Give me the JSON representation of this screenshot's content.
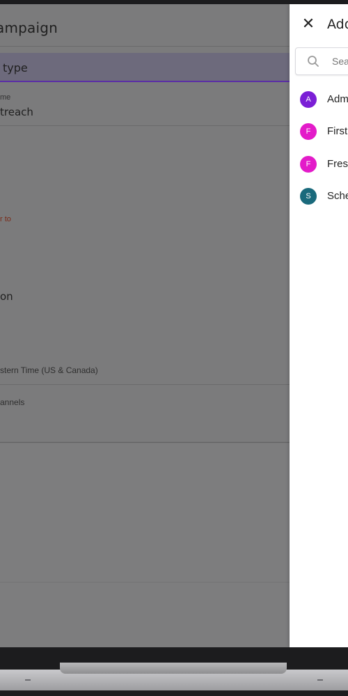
{
  "page": {
    "title": "ampaign",
    "type_field": "type",
    "name_label": "me",
    "name_value": "treach",
    "hint": "r to",
    "option_value": "on",
    "timezone": "stern Time (US & Canada)",
    "channels_label": "annels"
  },
  "drawer": {
    "title": "Add",
    "search_placeholder": "Sea",
    "items": [
      {
        "initial": "A",
        "label": "Adm",
        "color": "#7b1fd6"
      },
      {
        "initial": "F",
        "label": "First",
        "color": "#e31bc9"
      },
      {
        "initial": "F",
        "label": "Fres",
        "color": "#e31bc9"
      },
      {
        "initial": "S",
        "label": "Sche",
        "color": "#1a6a7c"
      }
    ]
  }
}
